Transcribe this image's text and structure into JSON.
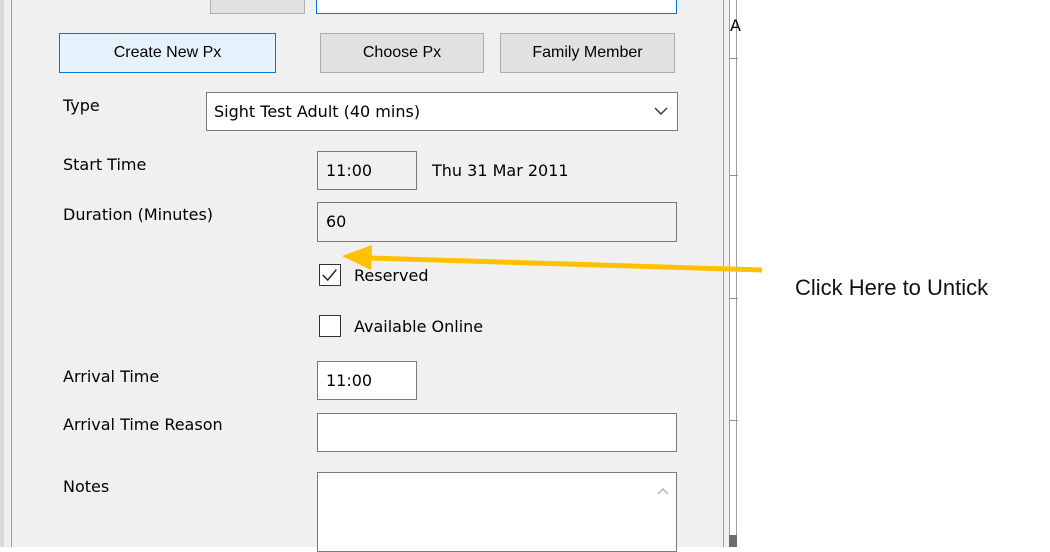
{
  "buttons": {
    "create_new_px": "Create New Px",
    "choose_px": "Choose Px",
    "family_member": "Family Member"
  },
  "type": {
    "label": "Type",
    "value": "Sight Test Adult (40 mins)"
  },
  "start_time": {
    "label": "Start Time",
    "value": "11:00",
    "date": "Thu 31 Mar 2011"
  },
  "duration": {
    "label": "Duration (Minutes)",
    "value": "60"
  },
  "reserved": {
    "label": "Reserved",
    "checked": true
  },
  "available_online": {
    "label": "Available Online",
    "checked": false
  },
  "arrival_time": {
    "label": "Arrival Time",
    "value": "11:00"
  },
  "arrival_reason": {
    "label": "Arrival Time Reason",
    "value": ""
  },
  "notes": {
    "label": "Notes",
    "value": ""
  },
  "background_window": {
    "partial_text": "A"
  },
  "annotation": {
    "text": "Click Here to Untick",
    "arrow_color": "#FFC000"
  },
  "icons": {
    "dropdown": "chevron-down-icon",
    "checkmark": "checkmark-icon",
    "scroll_up": "chevron-up-icon"
  },
  "colors": {
    "focus_border": "#0078d7",
    "dialog_bg": "#f0f0f0"
  }
}
